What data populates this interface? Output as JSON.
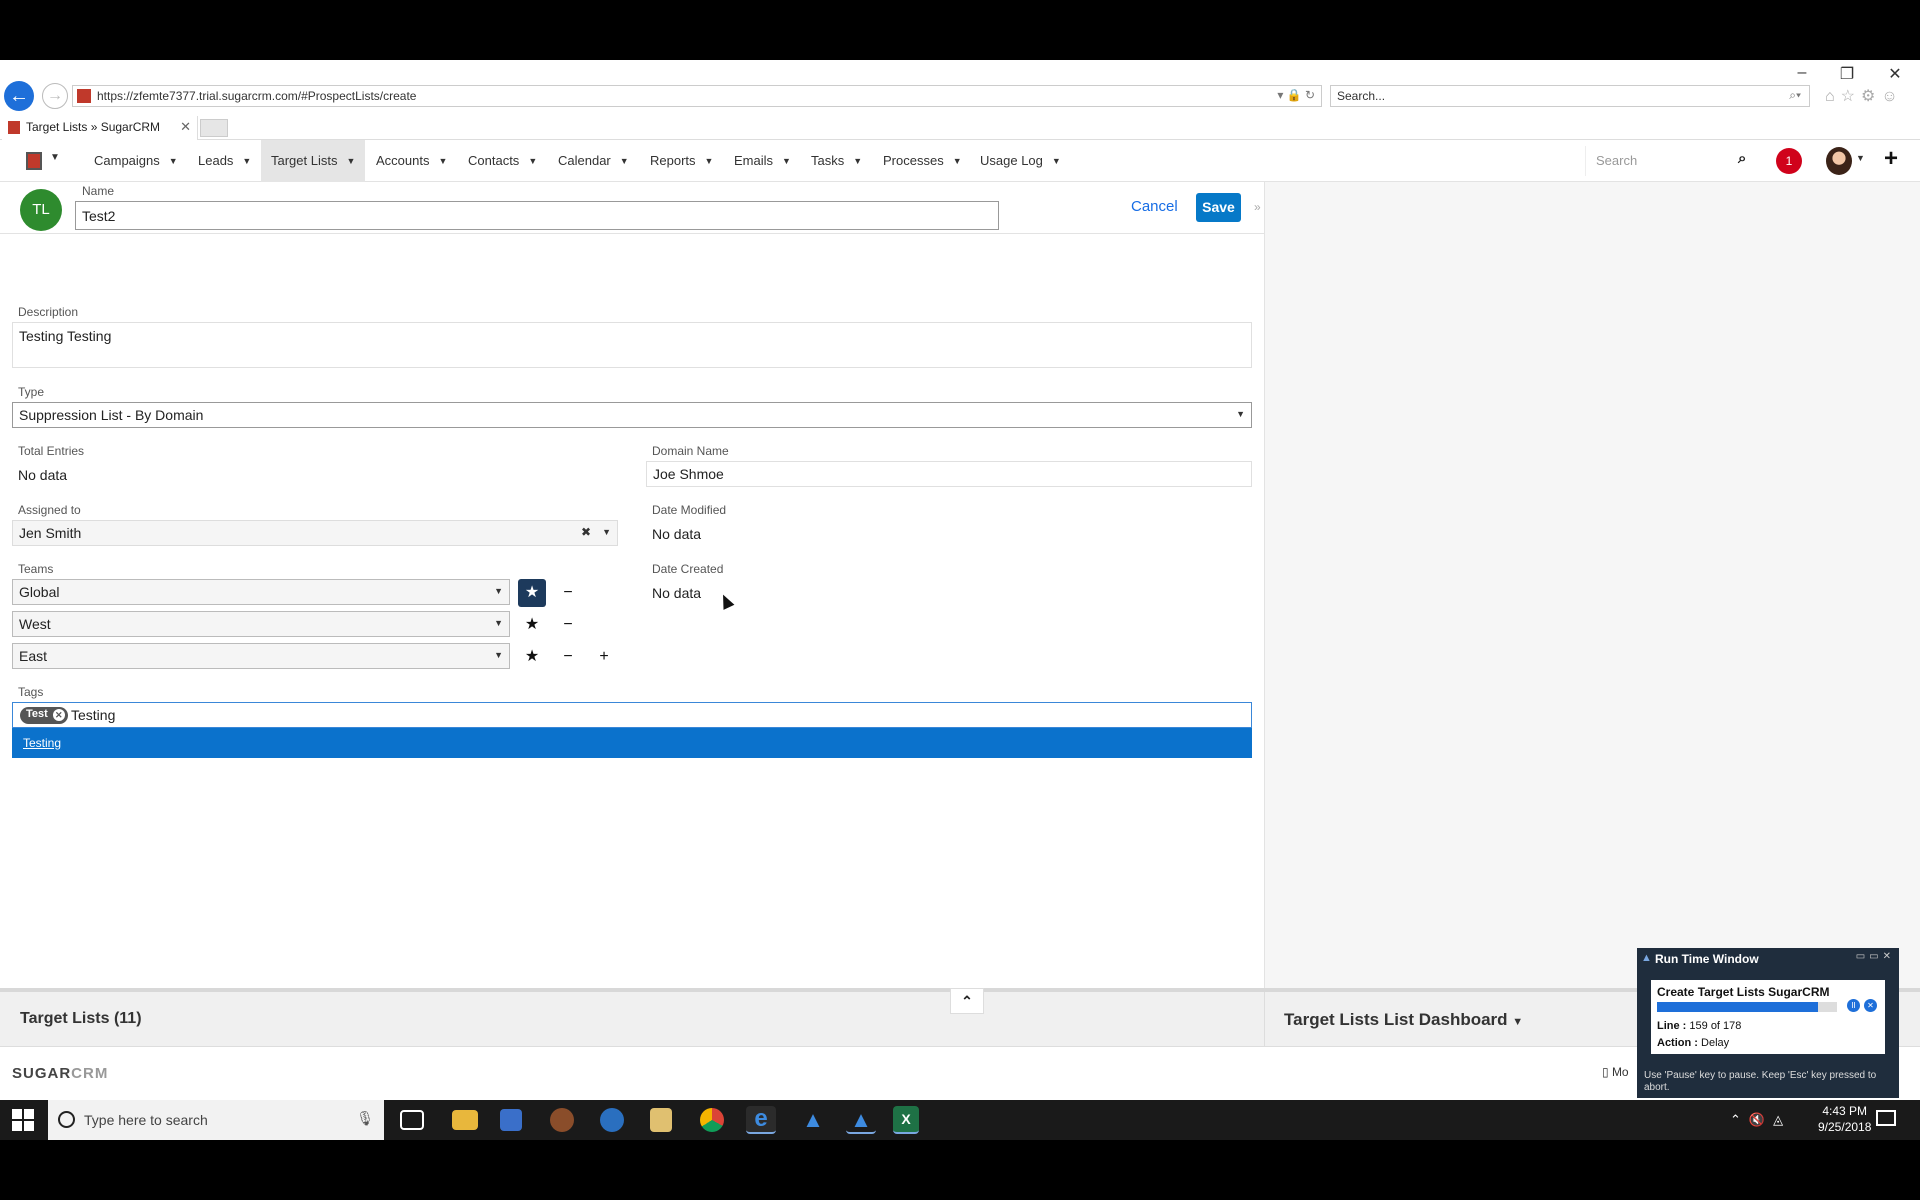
{
  "browser": {
    "url": "https://zfemte7377.trial.sugarcrm.com/#ProspectLists/create",
    "search_placeholder": "Search...",
    "tab_title": "Target Lists » SugarCRM"
  },
  "nav": {
    "items": [
      {
        "label": "Campaigns"
      },
      {
        "label": "Leads"
      },
      {
        "label": "Target Lists"
      },
      {
        "label": "Accounts"
      },
      {
        "label": "Contacts"
      },
      {
        "label": "Calendar"
      },
      {
        "label": "Reports"
      },
      {
        "label": "Emails"
      },
      {
        "label": "Tasks"
      },
      {
        "label": "Processes"
      },
      {
        "label": "Usage Log"
      }
    ],
    "search_placeholder": "Search",
    "notification_count": "1"
  },
  "record": {
    "module_badge": "TL",
    "name_label": "Name",
    "name_value": "Test2",
    "cancel_label": "Cancel",
    "save_label": "Save",
    "description_label": "Description",
    "description_value": "Testing Testing",
    "type_label": "Type",
    "type_value": "Suppression List - By Domain",
    "total_entries_label": "Total Entries",
    "total_entries_value": "No data",
    "domain_name_label": "Domain Name",
    "domain_name_value": "Joe Shmoe",
    "assigned_label": "Assigned to",
    "assigned_value": "Jen Smith",
    "date_modified_label": "Date Modified",
    "date_modified_value": "No data",
    "teams_label": "Teams",
    "teams": [
      "Global",
      "West",
      "East"
    ],
    "date_created_label": "Date Created",
    "date_created_value": "No data",
    "tags_label": "Tags",
    "tag_chip": "Test",
    "tag_typed": "Testing",
    "tag_suggestion": "Testing"
  },
  "footer": {
    "list_title": "Target Lists (11)",
    "dashboard_title": "Target Lists List Dashboard",
    "logo_sugar": "SUGAR",
    "logo_crm": "CRM",
    "mobile_label": "Mo"
  },
  "runtime": {
    "title": "Run Time Window",
    "task": "Create Target Lists SugarCRM",
    "progress_fraction": 0.893,
    "line_label": "Line :",
    "line_value": "159 of 178",
    "action_label": "Action :",
    "action_value": "Delay",
    "note": "Use 'Pause' key to pause. Keep 'Esc' key pressed to abort."
  },
  "taskbar": {
    "search_placeholder": "Type here to search",
    "time": "4:43 PM",
    "date": "9/25/2018"
  },
  "colors": {
    "accent": "#0679c8",
    "module_badge": "#2e8b2e",
    "notification": "#d0021b",
    "tag_highlight": "#0b72cc"
  }
}
